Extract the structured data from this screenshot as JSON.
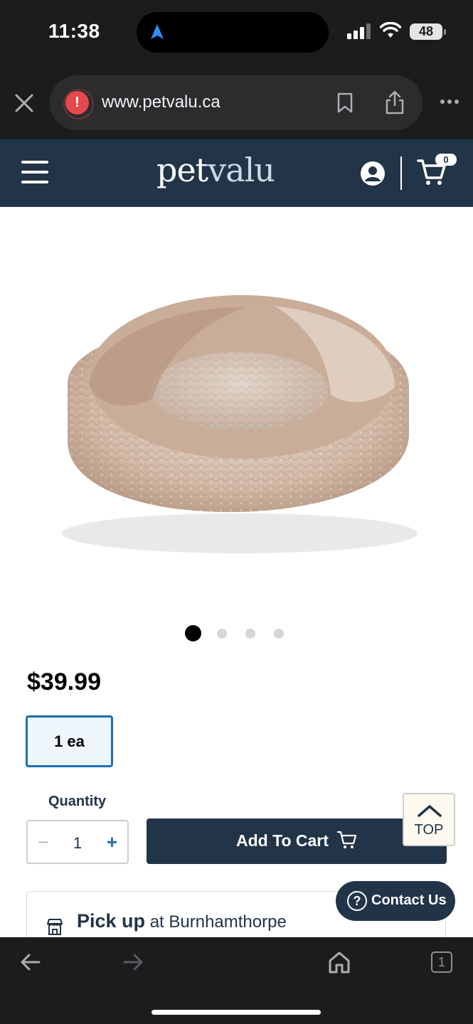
{
  "status_bar": {
    "time": "11:38",
    "battery": "48",
    "icons": [
      "navigation-arrow-icon",
      "signal-icon",
      "wifi-icon",
      "battery-icon"
    ]
  },
  "browser": {
    "url": "www.petvalu.ca",
    "security_icon": "warning-icon",
    "buttons": [
      "close-icon",
      "bookmark-icon",
      "share-icon",
      "more-icon"
    ]
  },
  "site_header": {
    "logo_part1": "pet",
    "logo_part2": "valu",
    "cart_count": "0",
    "icons": [
      "menu-icon",
      "account-icon",
      "cart-icon"
    ]
  },
  "product": {
    "image_alt": "plush donut pet bed",
    "carousel": {
      "total": 4,
      "active": 1
    },
    "price": "$39.99",
    "size_option": "1 ea",
    "quantity_label": "Quantity",
    "quantity_value": "1",
    "minus": "−",
    "plus": "+",
    "add_to_cart": "Add To Cart"
  },
  "floating": {
    "top_label": "TOP",
    "contact_label": "Contact Us",
    "contact_icon": "?"
  },
  "pickup": {
    "bold": "Pick up",
    "rest": " at Burnhamthorpe"
  },
  "bottom_toolbar": {
    "tabs_count": "1",
    "icons": [
      "back-icon",
      "forward-icon",
      "home-icon",
      "tabs-icon"
    ]
  },
  "colors": {
    "header_bg": "#223448",
    "accent_blue": "#1c6fb0",
    "chrome_bg": "#1c1c1e",
    "warning_red": "#e5484d"
  }
}
